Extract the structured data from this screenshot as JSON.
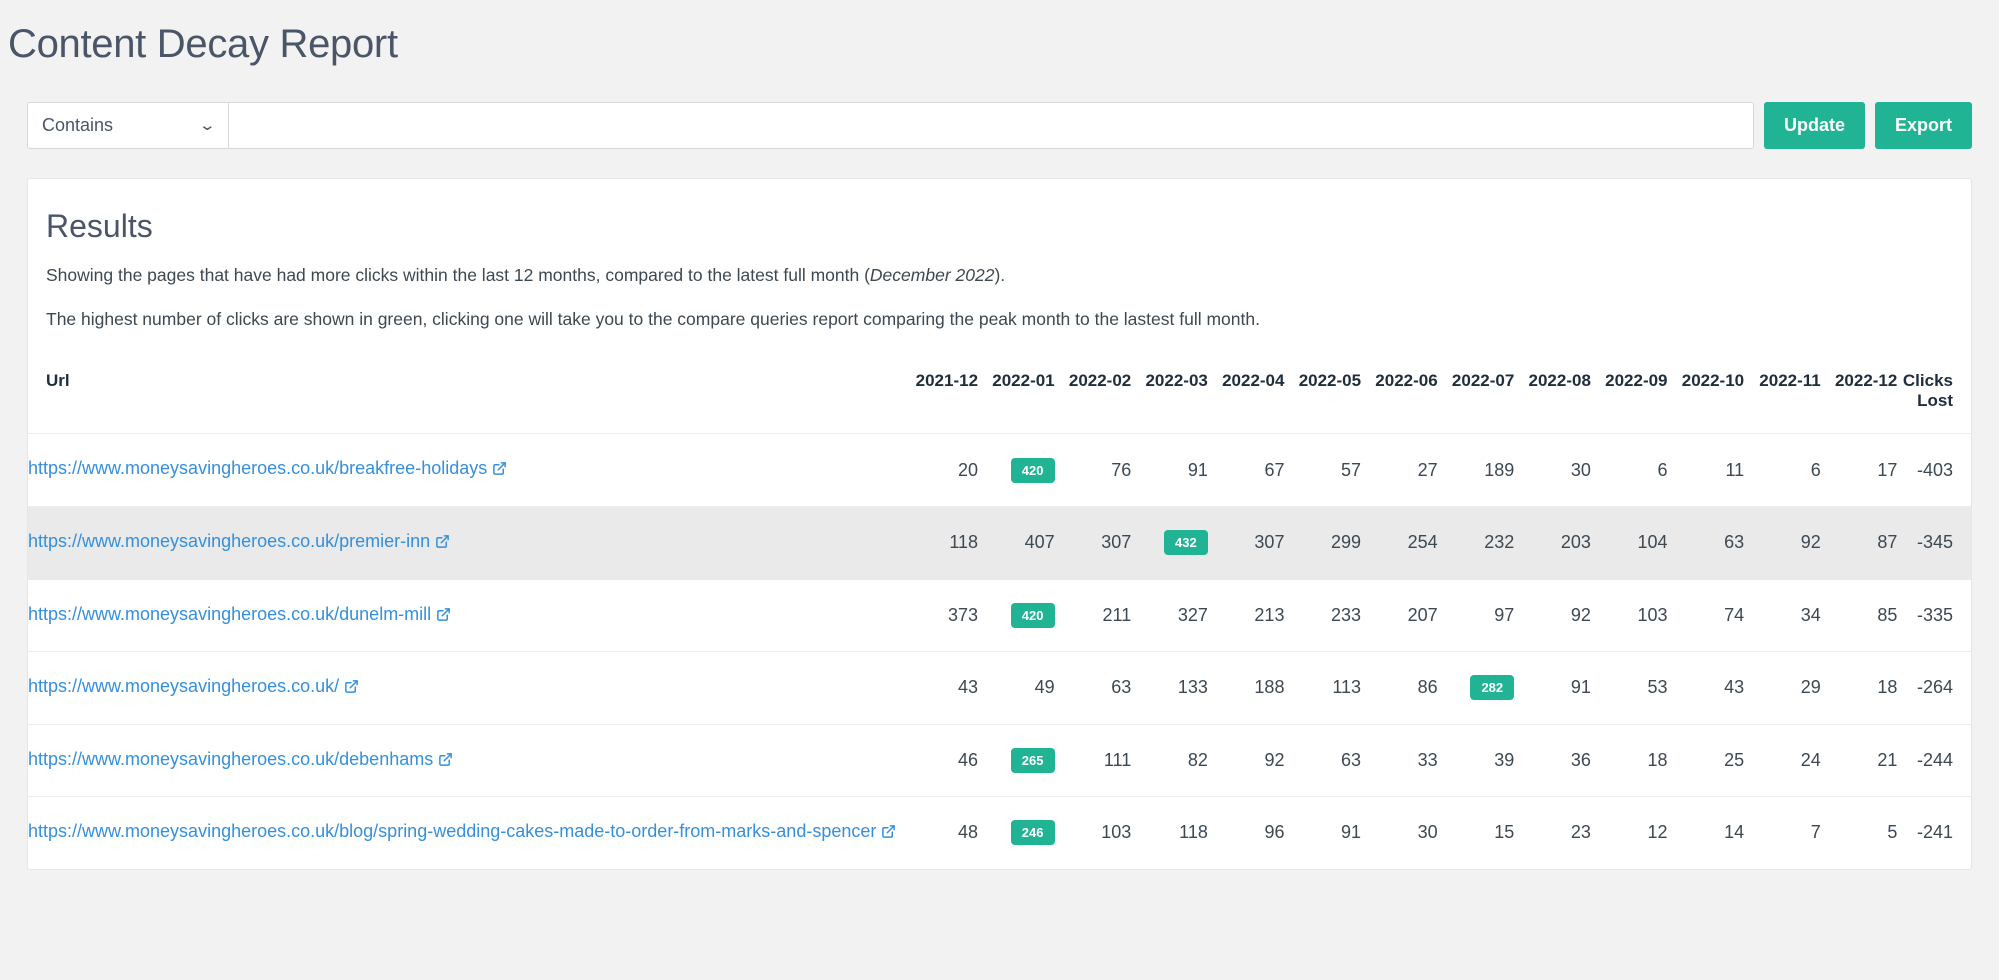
{
  "header": {
    "title": "Content Decay Report"
  },
  "filter": {
    "match_type": "Contains",
    "match_options": [
      "Contains"
    ],
    "query_value": "",
    "query_placeholder": "",
    "chevron": "⌄",
    "update_label": "Update",
    "export_label": "Export"
  },
  "results": {
    "title": "Results",
    "note_1_prefix": "Showing the pages that have had more clicks within the last 12 months, compared to the latest full month (",
    "note_1_month": "December 2022",
    "note_1_suffix": ").",
    "note_2": "The highest number of clicks are shown in green, clicking one will take you to the compare queries report comparing the peak month to the lastest full month.",
    "columns": {
      "url": "Url",
      "months": [
        "2021-12",
        "2022-01",
        "2022-02",
        "2022-03",
        "2022-04",
        "2022-05",
        "2022-06",
        "2022-07",
        "2022-08",
        "2022-09",
        "2022-10",
        "2022-11",
        "2022-12"
      ],
      "clicks_lost_line1": "Clicks",
      "clicks_lost_line2": "Lost"
    },
    "rows": [
      {
        "url": "https://www.moneysavingheroes.co.uk/breakfree-holidays",
        "values": [
          "20",
          "420",
          "76",
          "91",
          "67",
          "57",
          "27",
          "189",
          "30",
          "6",
          "11",
          "6",
          "17"
        ],
        "peak_index": 1,
        "clicks_lost": "-403",
        "highlight": false
      },
      {
        "url": "https://www.moneysavingheroes.co.uk/premier-inn",
        "values": [
          "118",
          "407",
          "307",
          "432",
          "307",
          "299",
          "254",
          "232",
          "203",
          "104",
          "63",
          "92",
          "87"
        ],
        "peak_index": 3,
        "clicks_lost": "-345",
        "highlight": true
      },
      {
        "url": "https://www.moneysavingheroes.co.uk/dunelm-mill",
        "values": [
          "373",
          "420",
          "211",
          "327",
          "213",
          "233",
          "207",
          "97",
          "92",
          "103",
          "74",
          "34",
          "85"
        ],
        "peak_index": 1,
        "clicks_lost": "-335",
        "highlight": false
      },
      {
        "url": "https://www.moneysavingheroes.co.uk/",
        "values": [
          "43",
          "49",
          "63",
          "133",
          "188",
          "113",
          "86",
          "282",
          "91",
          "53",
          "43",
          "29",
          "18"
        ],
        "peak_index": 7,
        "clicks_lost": "-264",
        "highlight": false
      },
      {
        "url": "https://www.moneysavingheroes.co.uk/debenhams",
        "values": [
          "46",
          "265",
          "111",
          "82",
          "92",
          "63",
          "33",
          "39",
          "36",
          "18",
          "25",
          "24",
          "21"
        ],
        "peak_index": 1,
        "clicks_lost": "-244",
        "highlight": false
      },
      {
        "url": "https://www.moneysavingheroes.co.uk/blog/spring-wedding-cakes-made-to-order-from-marks-and-spencer",
        "values": [
          "48",
          "246",
          "103",
          "118",
          "96",
          "91",
          "30",
          "15",
          "23",
          "12",
          "14",
          "7",
          "5"
        ],
        "peak_index": 1,
        "clicks_lost": "-241",
        "highlight": false
      }
    ]
  },
  "colors": {
    "accent_green": "#20b394",
    "link_blue": "#3490dc",
    "page_bg": "#f2f2f2",
    "row_highlight": "#eaeaea",
    "heading_text": "#4a5568"
  }
}
